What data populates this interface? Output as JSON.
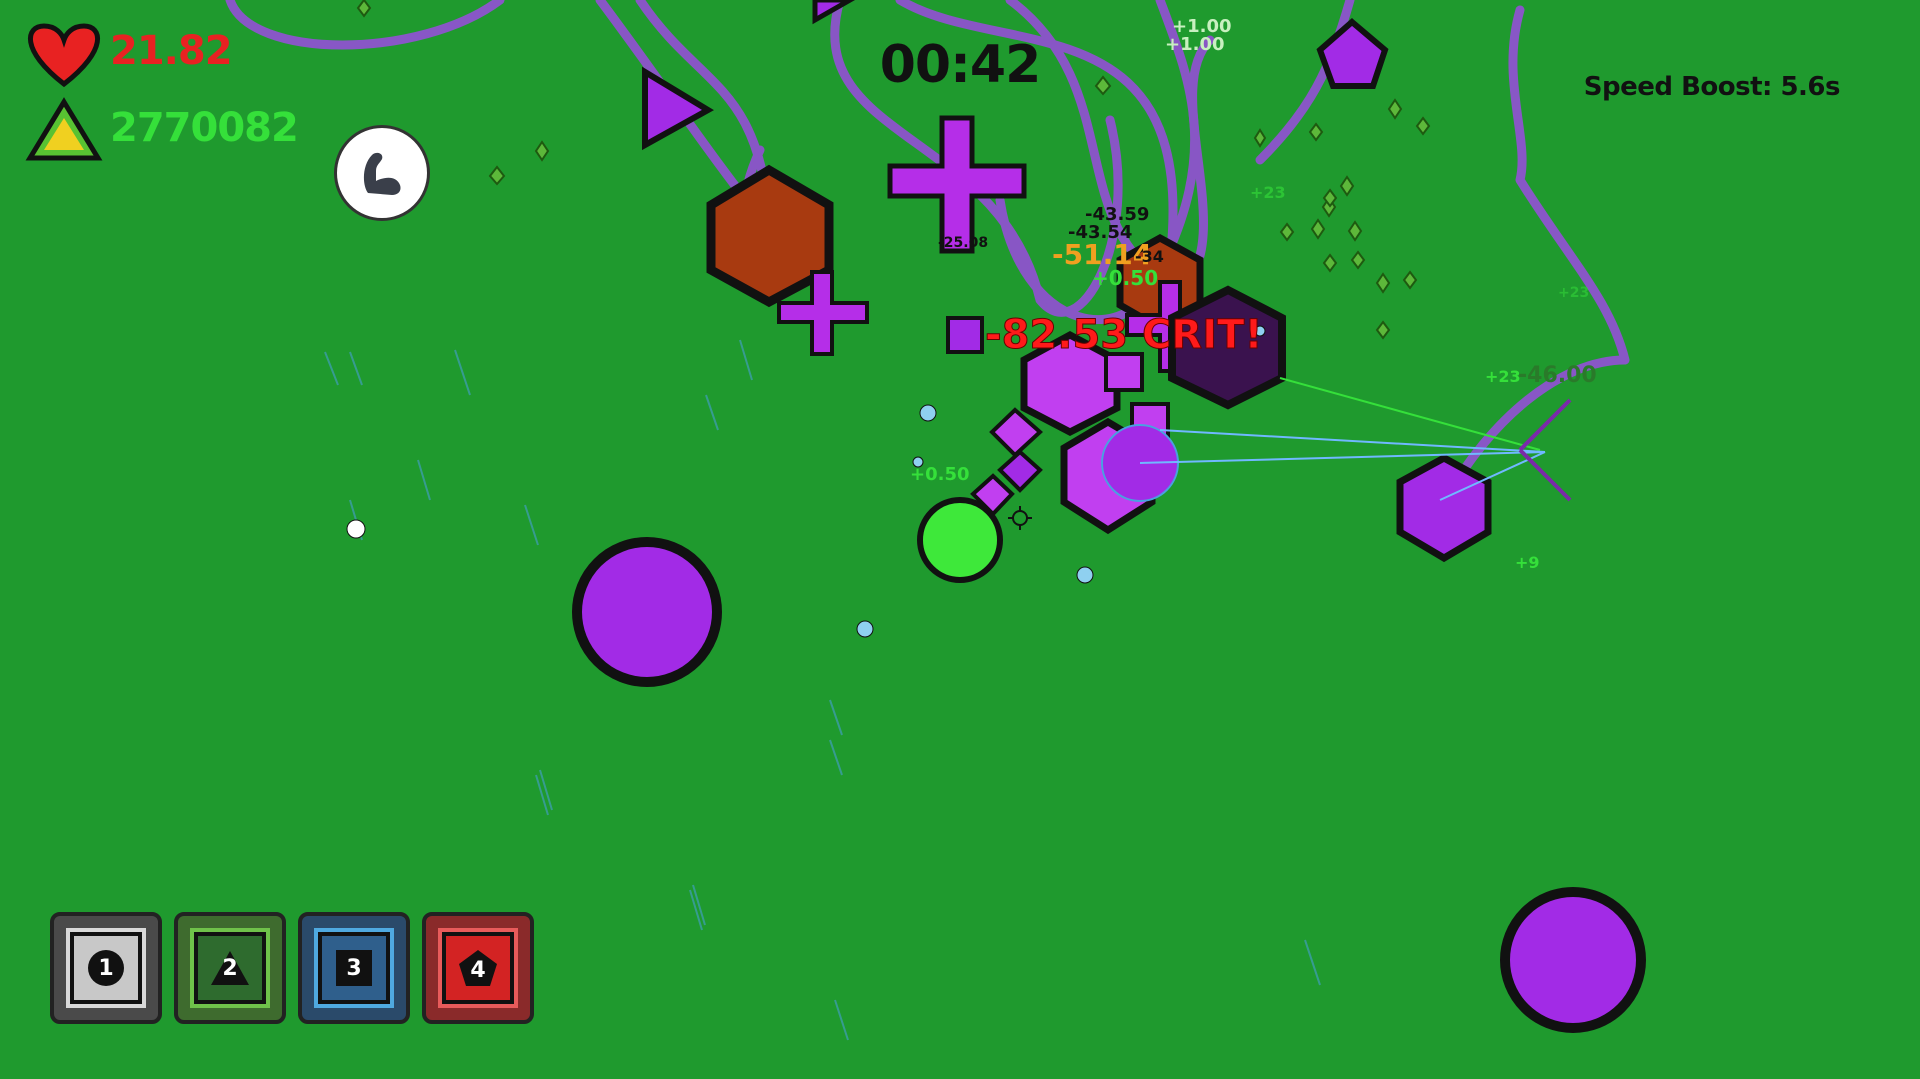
{
  "hud": {
    "health": "21.82",
    "score": "2770082",
    "timer": "00:42",
    "speed_boost": "Speed Boost: 5.6s",
    "health_icon": "heart-icon",
    "score_icon": "triangle-icon",
    "ability_icon": "flexed-arm-icon"
  },
  "hotbar": {
    "slots": [
      {
        "number": "1",
        "shape": "circle",
        "color": "#c8c8c8",
        "border": "#d9d9d9"
      },
      {
        "number": "2",
        "shape": "triangle",
        "color": "#2e6b2e",
        "border": "#6fc24a"
      },
      {
        "number": "3",
        "shape": "square",
        "color": "#2f5f8c",
        "border": "#4fa9e0"
      },
      {
        "number": "4",
        "shape": "pentagon",
        "color": "#d32323",
        "border": "#e85b5b"
      }
    ]
  },
  "floating_text": {
    "crit": "-82.53 CRIT!",
    "dmg_orange": "-51.14",
    "dmg1": "-43.59",
    "dmg2": "-43.54",
    "dmg3": "-25.08",
    "dmg4": "-46.00",
    "heal1": "+0.50",
    "heal2": "+0.50",
    "gain1": "+23",
    "gain2": "+23",
    "gain3": "+9",
    "gain4": "+1.00",
    "gain5": "+1.00",
    "gain6": "+23",
    "dmg5": "-34"
  },
  "colors": {
    "background": "#1f9a2e",
    "enemy_purple": "#a22be6",
    "enemy_dark": "#3a124e",
    "enemy_orange": "#a83a10",
    "player": "#3ee83a",
    "health_text": "#e82222",
    "score_text": "#35e03a",
    "crit_text": "#ff1a1a",
    "orange_text": "#f0a020"
  }
}
